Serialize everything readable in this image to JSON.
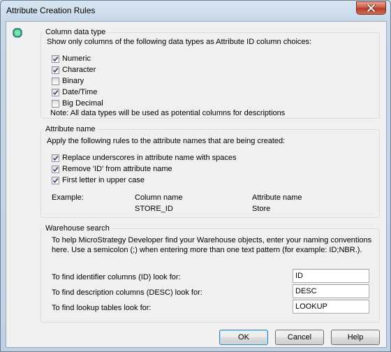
{
  "window": {
    "title": "Attribute Creation Rules"
  },
  "column_data_type": {
    "title": "Column data type",
    "instruction": "Show only columns of the following data types as Attribute ID column choices:",
    "options": [
      {
        "label": "Numeric",
        "checked": true
      },
      {
        "label": "Character",
        "checked": true
      },
      {
        "label": "Binary",
        "checked": false
      },
      {
        "label": "Date/Time",
        "checked": true
      },
      {
        "label": "Big Decimal",
        "checked": false
      }
    ],
    "note": "Note: All data types will be used as potential columns for descriptions"
  },
  "attribute_name": {
    "title": "Attribute name",
    "instruction": "Apply the following rules to the attribute names that are being created:",
    "options": [
      {
        "label": "Replace underscores in attribute name with spaces",
        "checked": true
      },
      {
        "label": "Remove 'ID' from attribute name",
        "checked": true
      },
      {
        "label": "First letter in upper case",
        "checked": true
      }
    ],
    "example_label": "Example:",
    "column_name_header": "Column name",
    "attribute_name_header": "Attribute name",
    "example_column": "STORE_ID",
    "example_attribute": "Store"
  },
  "warehouse_search": {
    "title": "Warehouse search",
    "help_line1": "To help MicroStrategy Developer find your Warehouse objects, enter your naming conventions",
    "help_line2": "here. Use a semicolon (;) when entering more than one text pattern (for example: ID;NBR.).",
    "fields": [
      {
        "label": "To find identifier columns (ID) look for:",
        "value": "ID"
      },
      {
        "label": "To find description columns (DESC) look for:",
        "value": "DESC"
      },
      {
        "label": "To find lookup tables look for:",
        "value": "LOOKUP"
      }
    ]
  },
  "buttons": {
    "ok": "OK",
    "cancel": "Cancel",
    "help": "Help"
  }
}
